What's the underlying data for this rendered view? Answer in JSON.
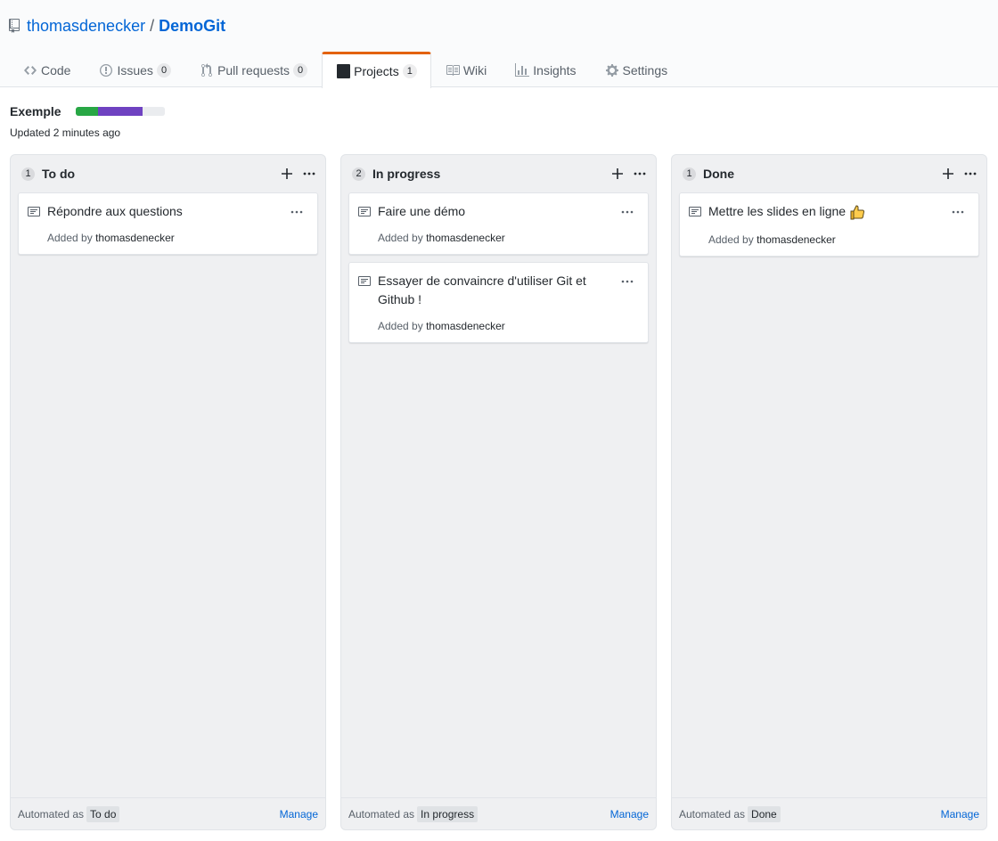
{
  "repo": {
    "owner": "thomasdenecker",
    "separator": "/",
    "name": "DemoGit"
  },
  "tabs": [
    {
      "label": "Code",
      "counter": null,
      "icon": "code-icon"
    },
    {
      "label": "Issues",
      "counter": "0",
      "icon": "issue-opened-icon"
    },
    {
      "label": "Pull requests",
      "counter": "0",
      "icon": "git-pull-request-icon"
    },
    {
      "label": "Projects",
      "counter": "1",
      "icon": "project-icon",
      "selected": true
    },
    {
      "label": "Wiki",
      "counter": null,
      "icon": "book-icon"
    },
    {
      "label": "Insights",
      "counter": null,
      "icon": "graph-icon"
    },
    {
      "label": "Settings",
      "counter": null,
      "icon": "gear-icon"
    }
  ],
  "project": {
    "name": "Exemple",
    "updated": "Updated 2 minutes ago",
    "progress": {
      "done": 0.25,
      "in_progress": 0.5,
      "todo": 0.25
    },
    "colors": {
      "done": "#28a745",
      "in_progress": "#6f42c1",
      "todo": "#eaecef"
    }
  },
  "columns": [
    {
      "count": "1",
      "name": "To do",
      "automated_label": "Automated as",
      "automated_value": "To do",
      "manage": "Manage",
      "cards": [
        {
          "title": "Répondre aux questions",
          "added_prefix": "Added by",
          "user": "thomasdenecker"
        }
      ]
    },
    {
      "count": "2",
      "name": "In progress",
      "automated_label": "Automated as",
      "automated_value": "In progress",
      "manage": "Manage",
      "cards": [
        {
          "title": "Faire une démo",
          "added_prefix": "Added by",
          "user": "thomasdenecker"
        },
        {
          "title": "Essayer de convaincre d'utiliser Git et Github !",
          "added_prefix": "Added by",
          "user": "thomasdenecker"
        }
      ]
    },
    {
      "count": "1",
      "name": "Done",
      "automated_label": "Automated as",
      "automated_value": "Done",
      "manage": "Manage",
      "cards": [
        {
          "title": "Mettre les slides en ligne",
          "emoji": "thumbs-up-icon",
          "added_prefix": "Added by",
          "user": "thomasdenecker"
        }
      ]
    }
  ]
}
